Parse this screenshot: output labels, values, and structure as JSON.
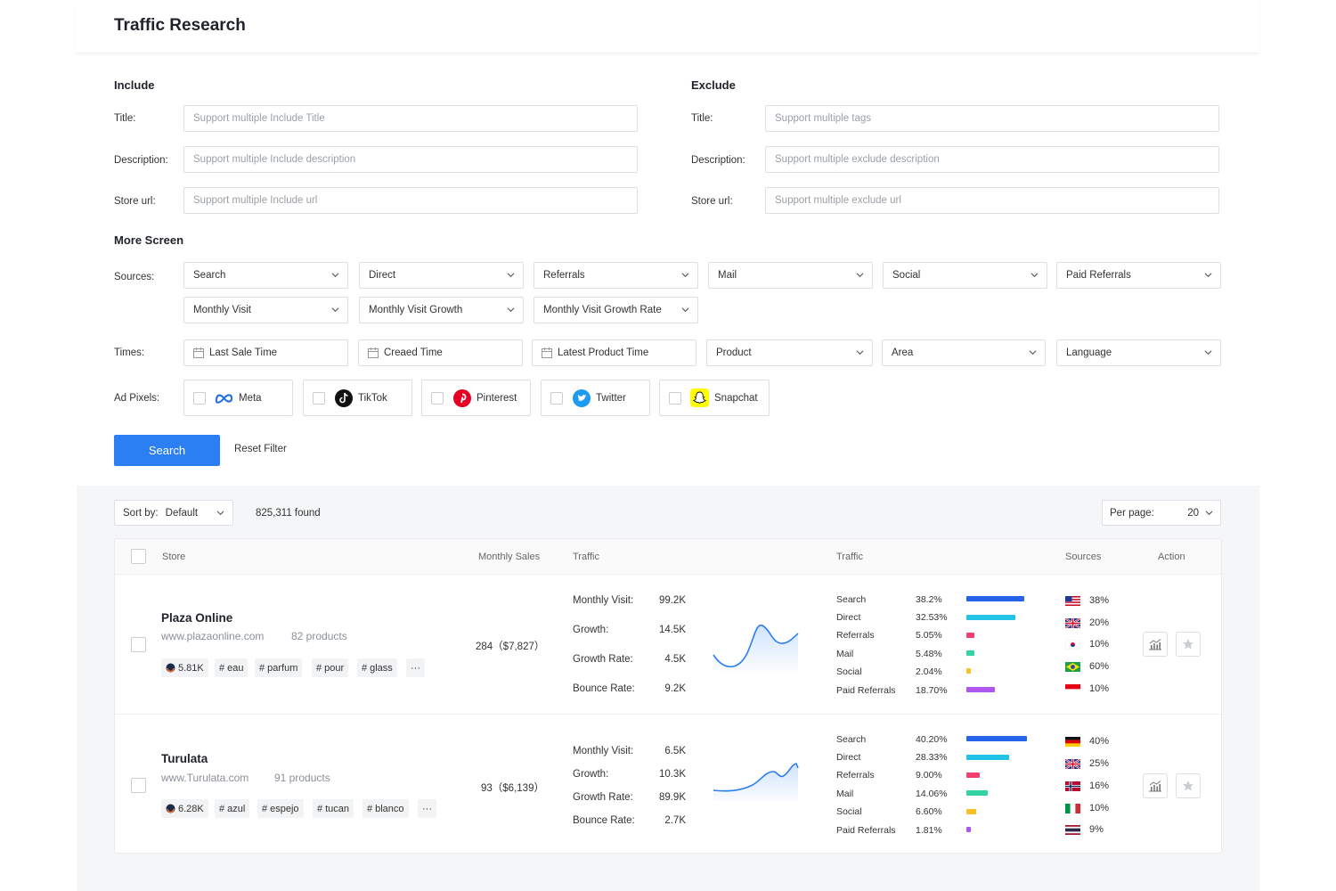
{
  "page": {
    "title": "Traffic Research"
  },
  "include": {
    "heading": "Include",
    "title_label": "Title:",
    "title_placeholder": "Support multiple Include Title",
    "description_label": "Description:",
    "description_placeholder": "Support multiple Include description",
    "url_label": "Store url:",
    "url_placeholder": "Support multiple Include url"
  },
  "exclude": {
    "heading": "Exclude",
    "title_label": "Title:",
    "title_placeholder": "Support multiple tags",
    "description_label": "Description:",
    "description_placeholder": "Support multiple exclude description",
    "url_label": "Store url:",
    "url_placeholder": "Support multiple exclude url"
  },
  "more": {
    "heading": "More Screen",
    "sources_label": "Sources:",
    "sources": [
      "Search",
      "Direct",
      "Referrals",
      "Mail",
      "Social",
      "Paid Referrals"
    ],
    "visits": [
      "Monthly Visit",
      "Monthly Visit Growth",
      "Monthly Visit Growth Rate"
    ],
    "times_label": "Times:",
    "times": [
      "Last Sale Time",
      "Creaed Time",
      "Latest Product Time"
    ],
    "filters": [
      "Product",
      "Area",
      "Language"
    ],
    "pixels_label": "Ad Pixels:",
    "pixels": [
      "Meta",
      "TikTok",
      "Pinterest",
      "Twitter",
      "Snapchat"
    ]
  },
  "actions": {
    "search": "Search",
    "reset": "Reset Filter"
  },
  "results": {
    "sort_label": "Sort by:",
    "sort_value": "Default",
    "found": "825,311 found",
    "per_page_label": "Per page:",
    "per_page_value": "20"
  },
  "table": {
    "headers": {
      "store": "Store",
      "monthly_sales": "Monthly Sales",
      "traffic": "Traffic",
      "traffic_sources": "Traffic",
      "sources": "Sources",
      "action": "Action"
    },
    "metric_labels": [
      "Monthly Visit:",
      "Growth:",
      "Growth Rate:",
      "Bounce Rate:"
    ],
    "source_labels": [
      "Search",
      "Direct",
      "Referrals",
      "Mail",
      "Social",
      "Paid Referrals"
    ],
    "source_colors": [
      "#2563eb",
      "#22c3e6",
      "#f43f6e",
      "#34d3a5",
      "#fbbf24",
      "#b055f0"
    ],
    "rows": [
      {
        "name": "Plaza Online",
        "url": "www.plazaonline.com",
        "products": "82 products",
        "score": "5.81K",
        "tags": [
          "eau",
          "parfum",
          "pour",
          "glass"
        ],
        "more": "···",
        "sales": "284（$7,827）",
        "metrics": [
          "99.2K",
          "14.5K",
          "4.5K",
          "9.2K"
        ],
        "source_values": [
          "38.2%",
          "32.53%",
          "5.05%",
          "5.48%",
          "2.04%",
          "18.70%"
        ],
        "source_fractions": [
          0.382,
          0.3253,
          0.0505,
          0.0548,
          0.0204,
          0.187
        ],
        "countries": [
          {
            "flag": "us-flag-icon",
            "value": "38%"
          },
          {
            "flag": "uk-flag-icon",
            "value": "20%"
          },
          {
            "flag": "kr-flag-icon",
            "value": "10%"
          },
          {
            "flag": "br-flag-icon",
            "value": "60%"
          },
          {
            "flag": "id-flag-icon",
            "value": "10%"
          }
        ]
      },
      {
        "name": "Turulata",
        "url": "www.Turulata.com",
        "products": "91 products",
        "score": "6.28K",
        "tags": [
          "azul",
          "espejo",
          "tucan",
          "blanco"
        ],
        "more": "···",
        "sales": "93（$6,139）",
        "metrics": [
          "6.5K",
          "10.3K",
          "89.9K",
          "2.7K"
        ],
        "source_values": [
          "40.20%",
          "28.33%",
          "9.00%",
          "14.06%",
          "6.60%",
          "1.81%"
        ],
        "source_fractions": [
          0.402,
          0.2833,
          0.09,
          0.1406,
          0.066,
          0.0181
        ],
        "countries": [
          {
            "flag": "de-flag-icon",
            "value": "40%"
          },
          {
            "flag": "uk-flag-icon",
            "value": "25%"
          },
          {
            "flag": "no-flag-icon",
            "value": "16%"
          },
          {
            "flag": "it-flag-icon",
            "value": "10%"
          },
          {
            "flag": "th-flag-icon",
            "value": "9%"
          }
        ]
      }
    ]
  }
}
